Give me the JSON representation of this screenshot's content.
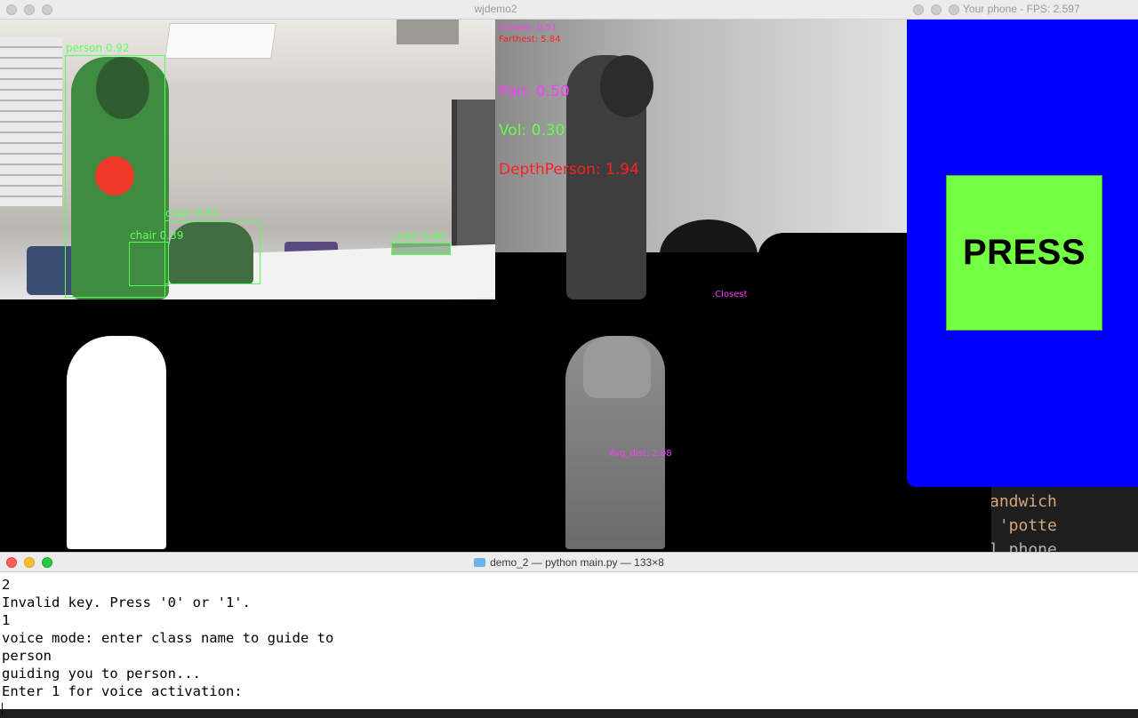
{
  "editor_peek": {
    "lines": [
      "andwich",
      " 'potte",
      "l_phone"
    ]
  },
  "main_window": {
    "title": "wjdemo2",
    "detections": [
      {
        "label": "person 0.92"
      },
      {
        "label": "chair 0.81"
      },
      {
        "label": "chair 0.39"
      },
      {
        "label": "chair 0.40"
      }
    ],
    "depth_overlay": {
      "closest": "Closest: 0.51",
      "farthest": "Farthest: 5.84",
      "pan": "Pan: 0.50",
      "vol": "Vol: 0.30",
      "depth_person": "DepthPerson: 1.94",
      "closest_marker": ".Closest",
      "avg_dist": "Avg_dist: 2.08"
    },
    "colors": {
      "pan": "#ff3cff",
      "vol": "#66ff44",
      "depth_person": "#ff2020",
      "closest": "#ff3cff",
      "farthest": "#ff2020"
    }
  },
  "phone_window": {
    "title": "Your phone - FPS: 2.597",
    "button_label": "PRESS",
    "colors": {
      "background": "#0000ff",
      "button": "#72ff44"
    }
  },
  "terminal": {
    "title": "demo_2 — python main.py — 133×8",
    "lines": [
      "2",
      "Invalid key. Press '0' or '1'.",
      "1",
      "voice mode: enter class name to guide to",
      "person",
      "guiding you to person...",
      "Enter 1 for voice activation:"
    ]
  }
}
